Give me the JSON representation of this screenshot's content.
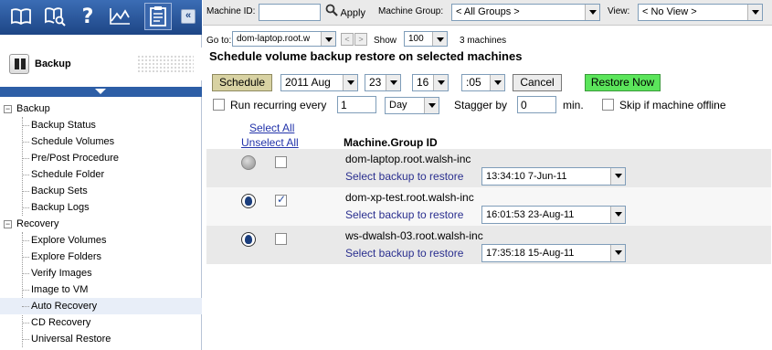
{
  "toolbar": {
    "icons": [
      "book-icon",
      "book-search-icon",
      "help-question-icon",
      "line-chart-icon",
      "clipboard-icon"
    ],
    "collapse_glyph": "«"
  },
  "module": {
    "title": "Backup"
  },
  "nav": {
    "groups": [
      {
        "label": "Backup",
        "expander": "−",
        "items": [
          "Backup Status",
          "Schedule Volumes",
          "Pre/Post Procedure",
          "Schedule Folder",
          "Backup Sets",
          "Backup Logs"
        ]
      },
      {
        "label": "Recovery",
        "expander": "−",
        "items": [
          "Explore Volumes",
          "Explore Folders",
          "Verify Images",
          "Image to VM",
          "Auto Recovery",
          "CD Recovery",
          "Universal Restore"
        ]
      }
    ],
    "selected": "Auto Recovery"
  },
  "filter": {
    "machine_id_label": "Machine ID:",
    "machine_id_value": "",
    "apply_label": "Apply",
    "machine_group_label": "Machine Group:",
    "machine_group_value": "< All Groups >",
    "view_label": "View:",
    "view_value": "< No View >"
  },
  "goto": {
    "label": "Go to:",
    "value": "dom-laptop.root.w",
    "show_label": "Show",
    "show_value": "100",
    "count_text": "3 machines"
  },
  "section_title": "Schedule volume backup restore on selected machines",
  "schedule": {
    "schedule_button": "Schedule",
    "month": "2011 Aug",
    "day": "23",
    "hour": "16",
    "minute": ":05",
    "cancel_button": "Cancel",
    "restore_now_button": "Restore Now",
    "recurring_label": "Run recurring every",
    "recurring_value": "1",
    "recurring_unit": "Day",
    "stagger_label": "Stagger by",
    "stagger_value": "0",
    "stagger_unit": "min.",
    "skip_offline_label": "Skip if machine offline"
  },
  "list": {
    "select_all": "Select All",
    "unselect_all": "Unselect All",
    "column_header": "Machine.Group ID",
    "select_backup_label": "Select backup to restore",
    "machines": [
      {
        "name": "dom-laptop.root.walsh-inc",
        "status": "offline",
        "checked": false,
        "backup": "13:34:10 7-Jun-11"
      },
      {
        "name": "dom-xp-test.root.walsh-inc",
        "status": "agent",
        "checked": true,
        "backup": "16:01:53 23-Aug-11"
      },
      {
        "name": "ws-dwalsh-03.root.walsh-inc",
        "status": "agent",
        "checked": false,
        "backup": "17:35:18 15-Aug-11"
      }
    ]
  },
  "colors": {
    "toolbar_blue": "#1f4c8f",
    "schedule_button": "#d8d2a3",
    "restore_now_button": "#5be55b",
    "selected_nav": "#e8eef8"
  }
}
